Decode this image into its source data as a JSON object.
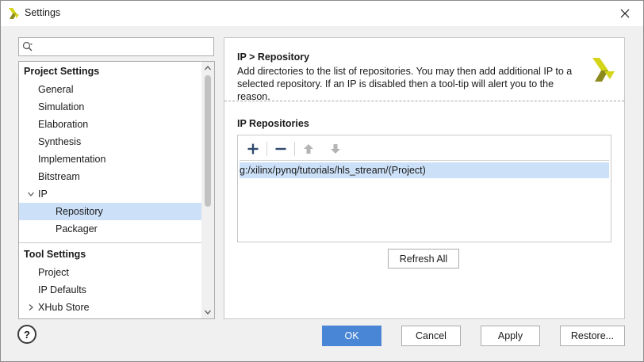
{
  "window": {
    "title": "Settings"
  },
  "search": {
    "value": "",
    "placeholder": ""
  },
  "tree": {
    "project_section": "Project Settings",
    "project_items": [
      {
        "label": "General"
      },
      {
        "label": "Simulation"
      },
      {
        "label": "Elaboration"
      },
      {
        "label": "Synthesis"
      },
      {
        "label": "Implementation"
      },
      {
        "label": "Bitstream"
      },
      {
        "label": "IP"
      }
    ],
    "ip_children": [
      {
        "label": "Repository",
        "selected": true
      },
      {
        "label": "Packager"
      }
    ],
    "tool_section": "Tool Settings",
    "tool_items": [
      {
        "label": "Project"
      },
      {
        "label": "IP Defaults"
      },
      {
        "label": "XHub Store"
      }
    ]
  },
  "page": {
    "title": "IP > Repository",
    "description": "Add directories to the list of repositories. You may then add additional IP to a selected repository. If an IP is disabled then a tool-tip will alert you to the reason.",
    "section_label": "IP Repositories",
    "repositories": [
      {
        "path": "g:/xilinx/pynq/tutorials/hls_stream/(Project)"
      }
    ],
    "refresh_label": "Refresh All"
  },
  "footer": {
    "help_label": "?",
    "ok_label": "OK",
    "cancel_label": "Cancel",
    "apply_label": "Apply",
    "restore_label": "Restore..."
  },
  "colors": {
    "accent": "#4a86d6",
    "selection": "#cce0f7",
    "logo_yellow": "#d4d419",
    "logo_olive": "#8a8a1e"
  },
  "icons": {
    "app": "xilinx-logo-icon",
    "close": "close-icon",
    "search": "search-icon",
    "add": "plus-icon",
    "remove": "minus-icon",
    "up": "arrow-up-icon",
    "down": "arrow-down-icon"
  }
}
